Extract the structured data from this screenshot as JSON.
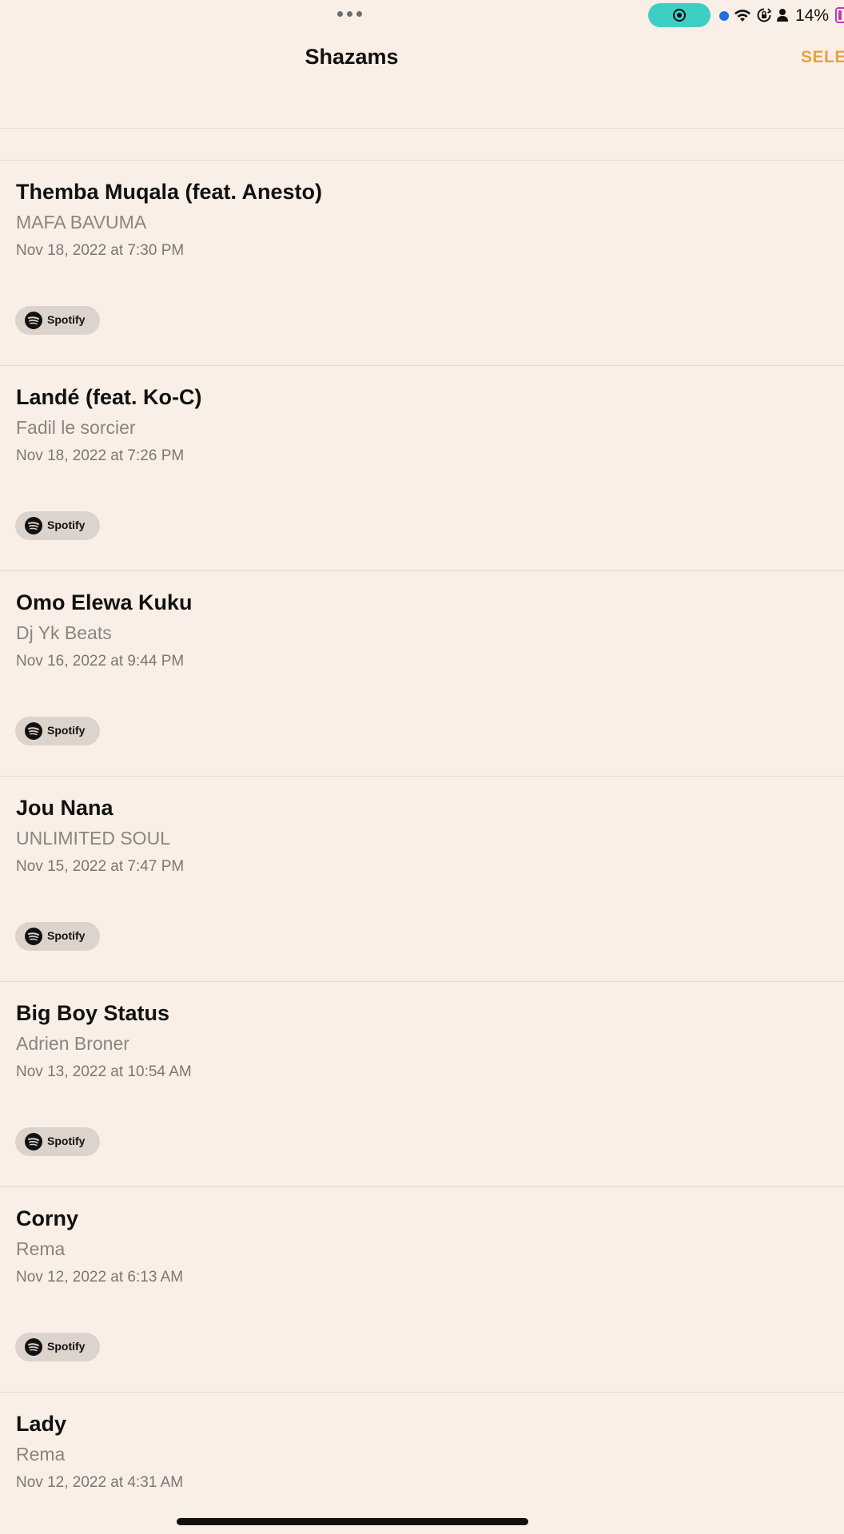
{
  "status_bar": {
    "battery": "14%",
    "icons": [
      "more-dots-icon",
      "screen-recording-icon",
      "blue-dot-indicator",
      "wifi-icon",
      "orientation-lock-icon",
      "person-icon",
      "battery-icon"
    ],
    "recording_color": "#3ECFC4",
    "battery_color": "#C13AB4"
  },
  "header": {
    "title": "Shazams",
    "select_label": "SELE",
    "accent": "#E8A23A"
  },
  "items": [
    {
      "title": "Themba Muqala (feat. Anesto)",
      "artist": "MAFA BAVUMA",
      "date": "Nov 18, 2022 at 7:30 PM",
      "service": "Spotify"
    },
    {
      "title": "Landé (feat. Ko-C)",
      "artist": "Fadil le sorcier",
      "date": "Nov 18, 2022 at 7:26 PM",
      "service": "Spotify"
    },
    {
      "title": "Omo Elewa Kuku",
      "artist": "Dj Yk Beats",
      "date": "Nov 16, 2022 at 9:44 PM",
      "service": "Spotify"
    },
    {
      "title": "Jou Nana",
      "artist": "UNLIMITED SOUL",
      "date": "Nov 15, 2022 at 7:47 PM",
      "service": "Spotify"
    },
    {
      "title": "Big Boy Status",
      "artist": "Adrien Broner",
      "date": "Nov 13, 2022 at 10:54 AM",
      "service": "Spotify"
    },
    {
      "title": "Corny",
      "artist": "Rema",
      "date": "Nov 12, 2022 at 6:13 AM",
      "service": "Spotify"
    },
    {
      "title": "Lady",
      "artist": "Rema",
      "date": "Nov 12, 2022 at 4:31 AM",
      "service": ""
    }
  ],
  "background": "#F9EFE6"
}
